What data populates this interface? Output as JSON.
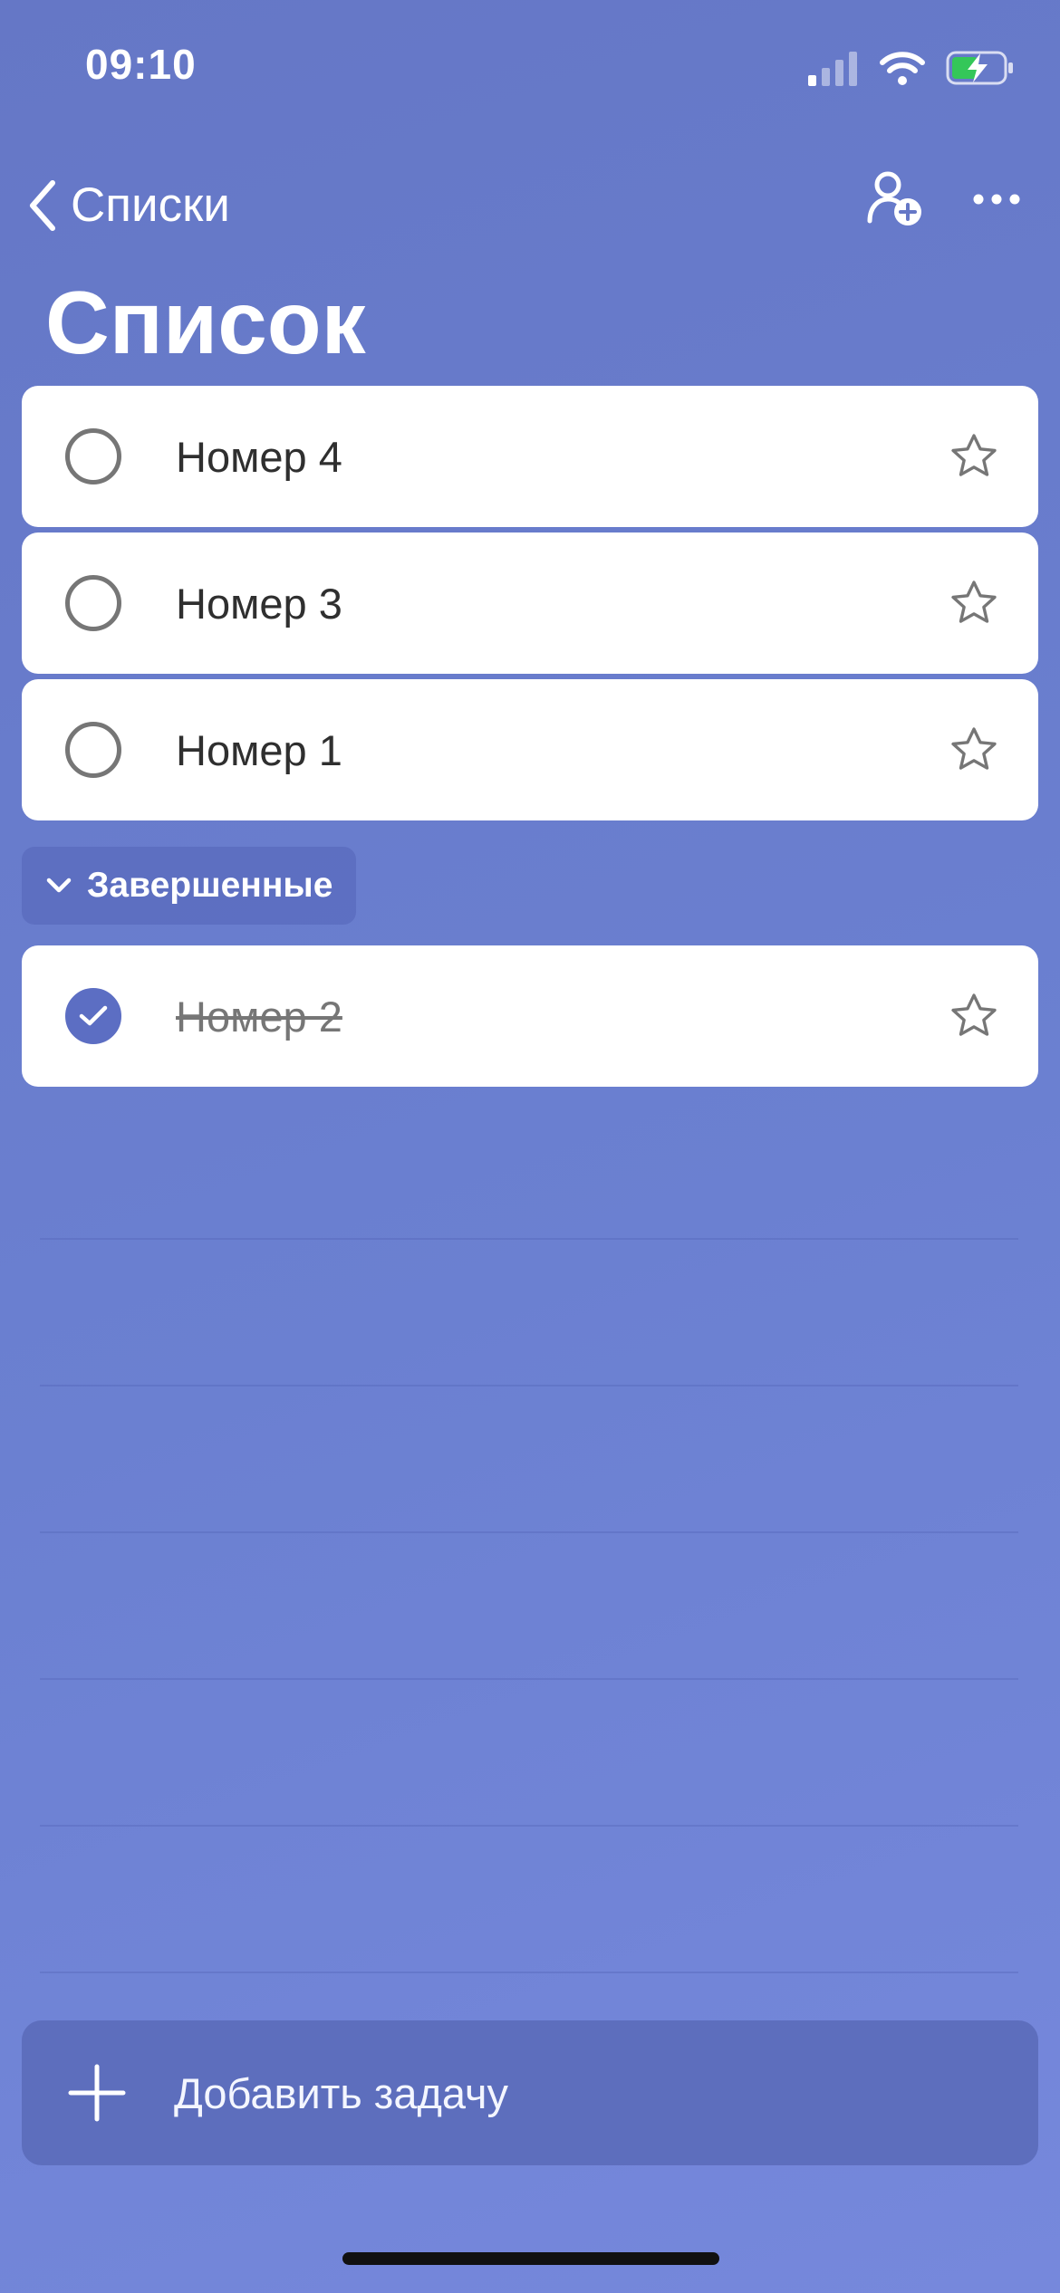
{
  "status_bar": {
    "time": "09:10",
    "battery_charging": true
  },
  "nav": {
    "back_label": "Списки",
    "title": "Список"
  },
  "tasks": [
    {
      "label": "Номер 4",
      "completed": false,
      "starred": false
    },
    {
      "label": "Номер 3",
      "completed": false,
      "starred": false
    },
    {
      "label": "Номер 1",
      "completed": false,
      "starred": false
    }
  ],
  "completed_section": {
    "label": "Завершенные",
    "expanded": true,
    "tasks": [
      {
        "label": "Номер 2",
        "completed": true,
        "starred": false
      }
    ]
  },
  "add_task": {
    "label": "Добавить задачу"
  },
  "colors": {
    "accent": "#5c6ec3",
    "background_top": "#6577c6",
    "background_bottom": "#7688dc",
    "card": "#ffffff",
    "text_dark": "#2f2f2f",
    "muted": "#767676"
  },
  "icons": [
    "cellular-signal-icon",
    "wifi-icon",
    "battery-icon",
    "chevron-left-icon",
    "add-person-icon",
    "more-icon",
    "empty-circle-icon",
    "checkmark-circle-icon",
    "star-icon",
    "chevron-down-icon",
    "plus-icon"
  ]
}
